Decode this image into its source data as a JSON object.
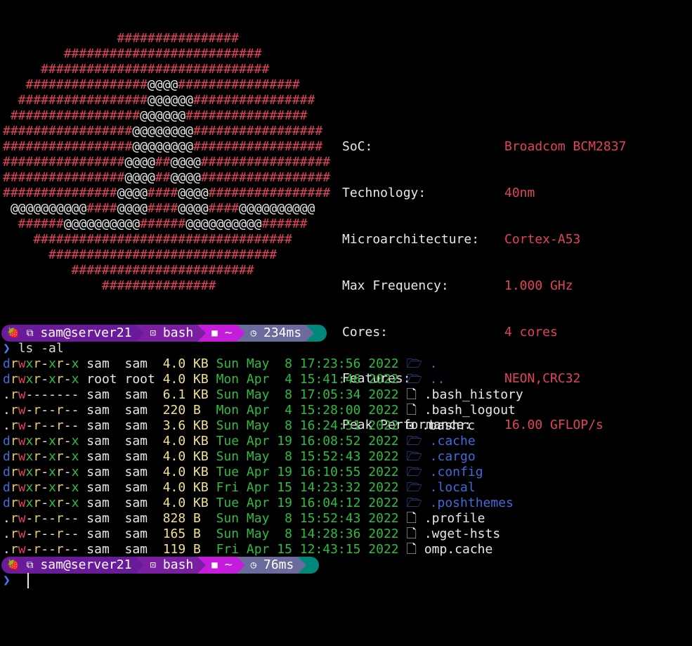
{
  "logo_art": [
    [
      [
        "#",
        "               ################"
      ]
    ],
    [
      [
        "#",
        "        ##########################"
      ]
    ],
    [
      [
        "#",
        "     ##############################"
      ]
    ],
    [
      [
        "#",
        "   ################"
      ],
      [
        "@",
        "@@@@"
      ],
      [
        "#",
        "################"
      ]
    ],
    [
      [
        "#",
        "  #################"
      ],
      [
        "@",
        "@@@@@@"
      ],
      [
        "#",
        "################"
      ]
    ],
    [
      [
        "#",
        " #################"
      ],
      [
        "@",
        "@@@@@@"
      ],
      [
        "#",
        "################"
      ]
    ],
    [
      [
        "#",
        "#################"
      ],
      [
        "@",
        "@@@@@@@@"
      ],
      [
        "#",
        "#################"
      ]
    ],
    [
      [
        "#",
        "#################"
      ],
      [
        "@",
        "@@@@@@@@"
      ],
      [
        "#",
        "#################"
      ]
    ],
    [
      [
        "#",
        "################"
      ],
      [
        "@",
        "@@@@"
      ],
      [
        "#",
        "##"
      ],
      [
        "@",
        "@@@@"
      ],
      [
        "#",
        "#################"
      ]
    ],
    [
      [
        "#",
        "################"
      ],
      [
        "@",
        "@@@@"
      ],
      [
        "#",
        "##"
      ],
      [
        "@",
        "@@@@"
      ],
      [
        "#",
        "#################"
      ]
    ],
    [
      [
        "#",
        "###############"
      ],
      [
        "@",
        "@@@@"
      ],
      [
        "#",
        "####"
      ],
      [
        "@",
        "@@@@"
      ],
      [
        "#",
        "################"
      ]
    ],
    [
      [
        "@",
        " @@@@@@@@@@"
      ],
      [
        "#",
        "####"
      ],
      [
        "@",
        "@@@@"
      ],
      [
        "#",
        "####"
      ],
      [
        "@",
        "@@@@"
      ],
      [
        "#",
        "####"
      ],
      [
        "@",
        "@@@@@@@@@@"
      ]
    ],
    [
      [
        "#",
        "  ######"
      ],
      [
        "@",
        "@@@@@@@@@@"
      ],
      [
        "#",
        "######"
      ],
      [
        "@",
        "@@@@@@@@@@"
      ],
      [
        "#",
        "######"
      ]
    ],
    [
      [
        "#",
        "    ##################################"
      ]
    ],
    [
      [
        "#",
        "      ##############################"
      ]
    ],
    [
      [
        "#",
        "         ########################"
      ]
    ],
    [
      [
        "#",
        "             ###############"
      ]
    ]
  ],
  "specs": [
    {
      "label": "SoC:",
      "value": "Broadcom BCM2837"
    },
    {
      "label": "Technology:",
      "value": "40nm"
    },
    {
      "label": "Microarchitecture:",
      "value": "Cortex-A53"
    },
    {
      "label": "Max Frequency:",
      "value": "1.000 GHz"
    },
    {
      "label": "Cores:",
      "value": "4 cores"
    },
    {
      "label": "Features:",
      "value": "NEON,CRC32"
    },
    {
      "label": "Peak Performance:",
      "value": "16.00 GFLOP/s"
    }
  ],
  "prompt1": {
    "user": "sam@server21",
    "shell": "bash",
    "path": "~",
    "time": "234ms"
  },
  "command1": {
    "chevron": "❯",
    "text": "ls -al"
  },
  "listing": [
    {
      "perm": "drwxr-xr-x",
      "owner": "sam ",
      "group": "sam ",
      "size": "4.0 KB",
      "date": "Sun May  8 17:23:56 2022",
      "icon": "folder-icon",
      "name": ".",
      "dir": true
    },
    {
      "perm": "drwxr-xr-x",
      "owner": "root",
      "group": "root",
      "size": "4.0 KB",
      "date": "Mon Apr  4 15:41:46 2022",
      "icon": "folder-icon",
      "name": "..",
      "dir": true
    },
    {
      "perm": ".rw-------",
      "owner": "sam ",
      "group": "sam ",
      "size": "6.1 KB",
      "date": "Sun May  8 17:05:34 2022",
      "icon": "file-icon",
      "name": ".bash_history",
      "dir": false
    },
    {
      "perm": ".rw-r--r--",
      "owner": "sam ",
      "group": "sam ",
      "size": "220 B ",
      "date": "Mon Apr  4 15:28:00 2022",
      "icon": "file-icon",
      "name": ".bash_logout",
      "dir": false
    },
    {
      "perm": ".rw-r--r--",
      "owner": "sam ",
      "group": "sam ",
      "size": "3.6 KB",
      "date": "Sun May  8 16:24:51 2022",
      "icon": "terminal-icon",
      "name": ".bashrc",
      "dir": false
    },
    {
      "perm": "drwxr-xr-x",
      "owner": "sam ",
      "group": "sam ",
      "size": "4.0 KB",
      "date": "Tue Apr 19 16:08:52 2022",
      "icon": "folder-icon",
      "name": ".cache",
      "dir": true
    },
    {
      "perm": "drwxr-xr-x",
      "owner": "sam ",
      "group": "sam ",
      "size": "4.0 KB",
      "date": "Sun May  8 15:52:43 2022",
      "icon": "folder-icon",
      "name": ".cargo",
      "dir": true
    },
    {
      "perm": "drwxr-xr-x",
      "owner": "sam ",
      "group": "sam ",
      "size": "4.0 KB",
      "date": "Tue Apr 19 16:10:55 2022",
      "icon": "folder-icon",
      "name": ".config",
      "dir": true
    },
    {
      "perm": "drwxr-xr-x",
      "owner": "sam ",
      "group": "sam ",
      "size": "4.0 KB",
      "date": "Fri Apr 15 14:23:32 2022",
      "icon": "folder-icon",
      "name": ".local",
      "dir": true
    },
    {
      "perm": "drwxr-xr-x",
      "owner": "sam ",
      "group": "sam ",
      "size": "4.0 KB",
      "date": "Tue Apr 19 16:04:12 2022",
      "icon": "folder-icon",
      "name": ".poshthemes",
      "dir": true
    },
    {
      "perm": ".rw-r--r--",
      "owner": "sam ",
      "group": "sam ",
      "size": "828 B ",
      "date": "Sun May  8 15:52:43 2022",
      "icon": "file-icon",
      "name": ".profile",
      "dir": false
    },
    {
      "perm": ".rw-r--r--",
      "owner": "sam ",
      "group": "sam ",
      "size": "165 B ",
      "date": "Sun May  8 14:28:36 2022",
      "icon": "file-icon",
      "name": ".wget-hsts",
      "dir": false
    },
    {
      "perm": ".rw-r--r--",
      "owner": "sam ",
      "group": "sam ",
      "size": "119 B ",
      "date": "Fri Apr 15 12:43:15 2022",
      "icon": "file-icon",
      "name": "omp.cache",
      "dir": false
    }
  ],
  "prompt2": {
    "user": "sam@server21",
    "shell": "bash",
    "path": "~",
    "time": "76ms"
  },
  "command2": {
    "chevron": "❯",
    "text": ""
  },
  "colors": {
    "logo_red": "#e0445a",
    "prompt_purple": "#6a1b9a",
    "prompt_magenta": "#c51ddb",
    "prompt_gray": "#6c6b9e",
    "prompt_teal": "#00897b",
    "dir_blue": "#3f6bd8",
    "date_green": "#2ebd3f"
  }
}
